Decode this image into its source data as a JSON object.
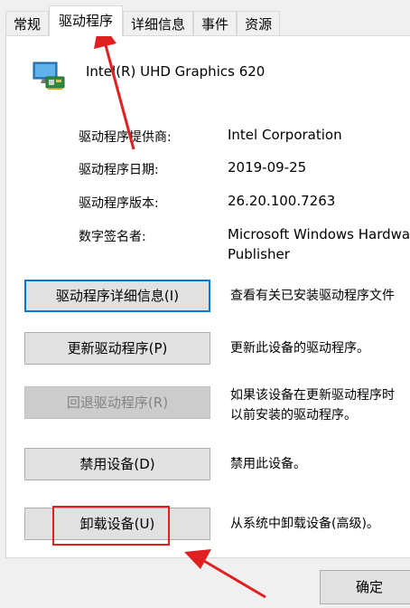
{
  "tabs": [
    {
      "label": "常规"
    },
    {
      "label": "驱动程序"
    },
    {
      "label": "详细信息"
    },
    {
      "label": "事件"
    },
    {
      "label": "资源"
    }
  ],
  "device": {
    "name": "Intel(R) UHD Graphics 620",
    "icon": "display-adapter-icon"
  },
  "properties": {
    "provider_label": "驱动程序提供商:",
    "provider_value": "Intel Corporation",
    "date_label": "驱动程序日期:",
    "date_value": "2019-09-25",
    "version_label": "驱动程序版本:",
    "version_value": "26.20.100.7263",
    "signer_label": "数字签名者:",
    "signer_value_line1": "Microsoft Windows Hardware",
    "signer_value_line2": "Publisher"
  },
  "actions": {
    "details_button": "驱动程序详细信息(I)",
    "details_desc": "查看有关已安装驱动程序文件",
    "update_button": "更新驱动程序(P)",
    "update_desc": "更新此设备的驱动程序。",
    "rollback_button": "回退驱动程序(R)",
    "rollback_desc_line1": "如果该设备在更新驱动程序时",
    "rollback_desc_line2": "以前安装的驱动程序。",
    "disable_button": "禁用设备(D)",
    "disable_desc": "禁用此设备。",
    "uninstall_button": "卸载设备(U)",
    "uninstall_desc": "从系统中卸载设备(高级)。"
  },
  "footer": {
    "ok_button": "确定"
  },
  "colors": {
    "annotation_red": "#e02020",
    "focus_blue": "#0078d7"
  }
}
